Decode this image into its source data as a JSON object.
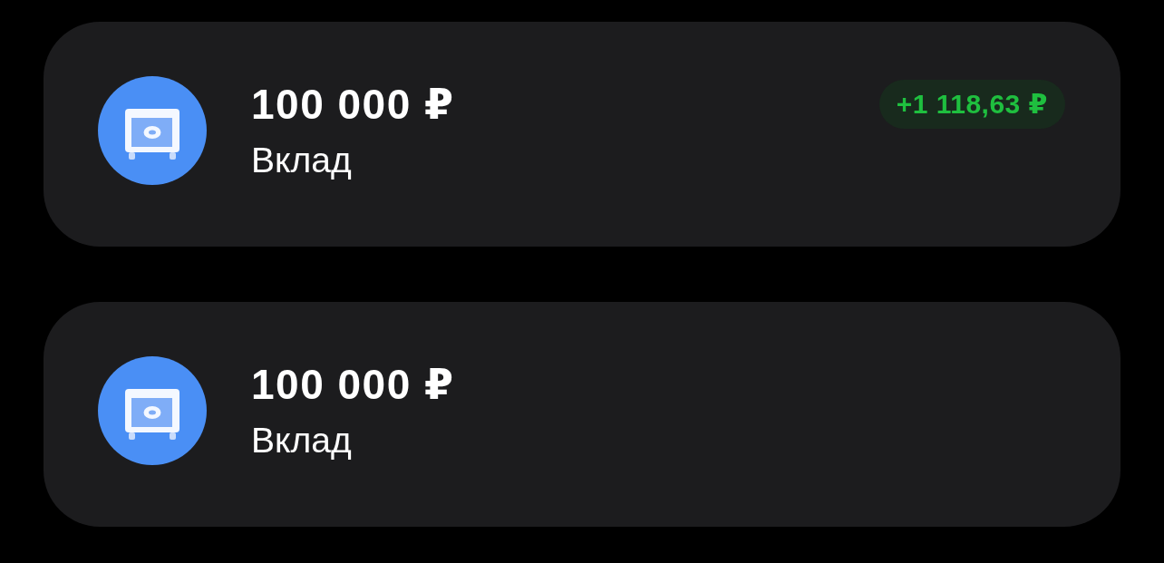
{
  "cards": [
    {
      "amount": "100 000 ₽",
      "label": "Вклад",
      "badge": "+1 118,63 ₽"
    },
    {
      "amount": "100 000 ₽",
      "label": "Вклад"
    }
  ]
}
